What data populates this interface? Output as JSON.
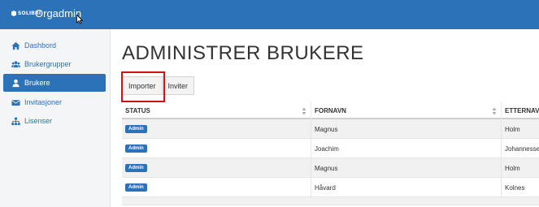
{
  "header": {
    "logo_text": "SOLIBRI",
    "app_title": "Orgadmin"
  },
  "sidebar": {
    "items": [
      {
        "label": "Dashbord",
        "icon": "home-icon",
        "active": false
      },
      {
        "label": "Brukergrupper",
        "icon": "users-icon",
        "active": false
      },
      {
        "label": "Brukere",
        "icon": "user-icon",
        "active": true
      },
      {
        "label": "Invitasjoner",
        "icon": "envelope-icon",
        "active": false
      },
      {
        "label": "Lisenser",
        "icon": "sitemap-icon",
        "active": false
      }
    ]
  },
  "main": {
    "title": "ADMINISTRER BRUKERE",
    "buttons": {
      "import_label": "Importer",
      "invite_label": "Inviter"
    },
    "table": {
      "columns": [
        "STATUS",
        "FORNAVN",
        "ETTERNAVN"
      ],
      "rows": [
        {
          "status": "Admin",
          "first_name": "Magnus",
          "last_name": "Holm"
        },
        {
          "status": "Admin",
          "first_name": "Joachim",
          "last_name": "Johannessen"
        },
        {
          "status": "Admin",
          "first_name": "Magnus",
          "last_name": "Holm"
        },
        {
          "status": "Admin",
          "first_name": "Håvard",
          "last_name": "Kolnes"
        }
      ]
    }
  },
  "colors": {
    "brand": "#2b72b8",
    "highlight": "#d0121b"
  }
}
